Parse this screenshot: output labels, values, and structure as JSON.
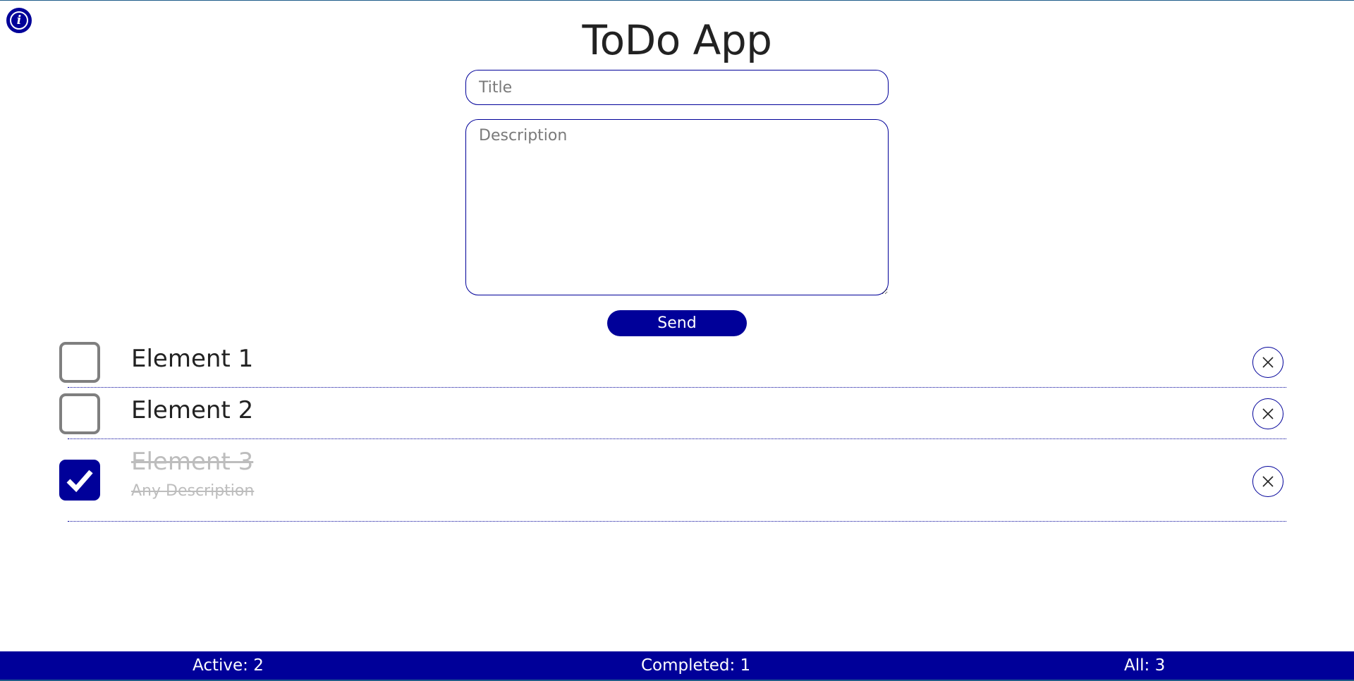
{
  "header": {
    "info_icon": "info-icon",
    "title": "ToDo App"
  },
  "form": {
    "title_placeholder": "Title",
    "title_value": "",
    "description_placeholder": "Description",
    "description_value": "",
    "send_label": "Send"
  },
  "todos": [
    {
      "title": "Element 1",
      "description": "",
      "completed": false
    },
    {
      "title": "Element 2",
      "description": "",
      "completed": false
    },
    {
      "title": "Element 3",
      "description": "Any Description",
      "completed": true
    }
  ],
  "footer": {
    "active": "Active: 2",
    "completed": "Completed: 1",
    "all": "All: 3"
  },
  "colors": {
    "accent": "#000099",
    "muted_text": "#bdbdbd",
    "checkbox_border": "#7f7f7f",
    "divider": "#000099"
  }
}
